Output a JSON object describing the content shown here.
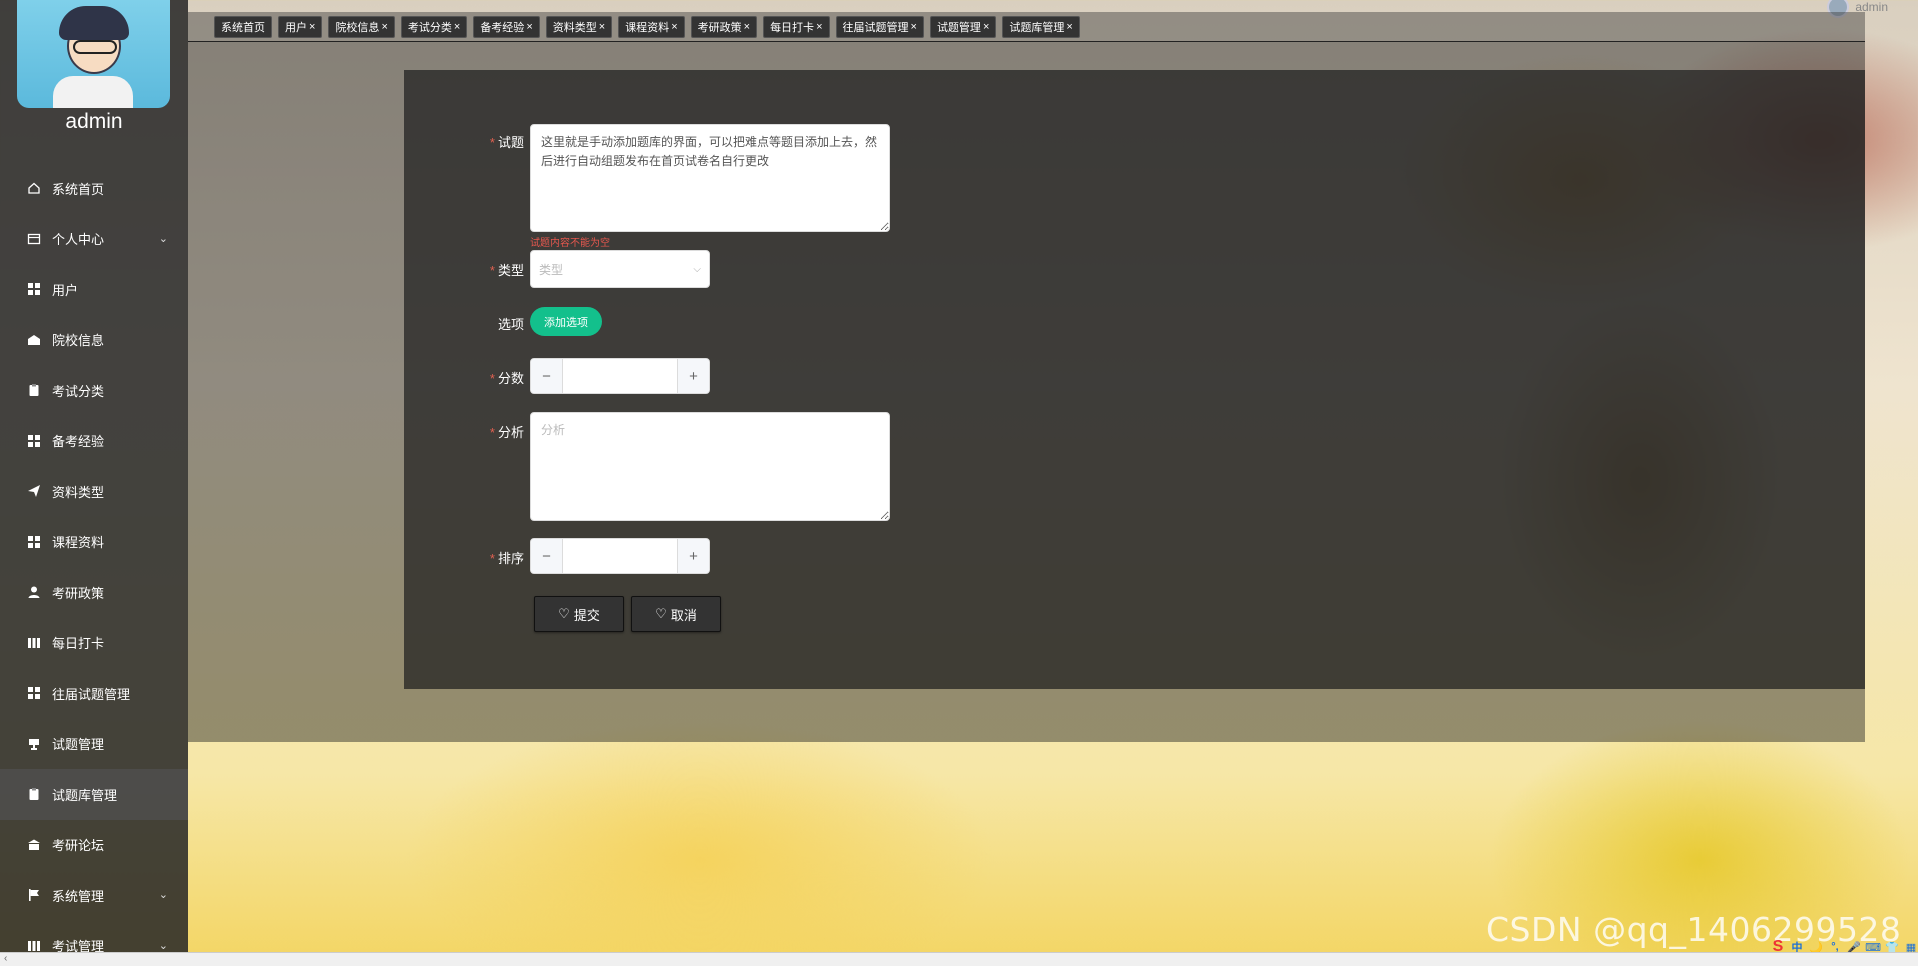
{
  "sidebar": {
    "username": "admin",
    "items": [
      {
        "label": "系统首页",
        "icon": "home-icon",
        "expand": false
      },
      {
        "label": "个人中心",
        "icon": "profile-icon",
        "expand": true
      },
      {
        "label": "用户",
        "icon": "grid-icon",
        "expand": false
      },
      {
        "label": "院校信息",
        "icon": "school-icon",
        "expand": false
      },
      {
        "label": "考试分类",
        "icon": "clipboard-icon",
        "expand": false
      },
      {
        "label": "备考经验",
        "icon": "grid-icon",
        "expand": false
      },
      {
        "label": "资料类型",
        "icon": "send-icon",
        "expand": false
      },
      {
        "label": "课程资料",
        "icon": "grid-icon",
        "expand": false
      },
      {
        "label": "考研政策",
        "icon": "user-icon",
        "expand": false
      },
      {
        "label": "每日打卡",
        "icon": "chart-icon",
        "expand": false
      },
      {
        "label": "往届试题管理",
        "icon": "grid-icon",
        "expand": false
      },
      {
        "label": "试题管理",
        "icon": "cup-icon",
        "expand": false
      },
      {
        "label": "试题库管理",
        "icon": "clipboard-icon",
        "expand": false,
        "active": true
      },
      {
        "label": "考研论坛",
        "icon": "bank-icon",
        "expand": false
      },
      {
        "label": "系统管理",
        "icon": "flag-icon",
        "expand": true
      },
      {
        "label": "考试管理",
        "icon": "chart-icon",
        "expand": true
      }
    ]
  },
  "top_user": "admin",
  "tabs": [
    "系统首页",
    "用户",
    "院校信息",
    "考试分类",
    "备考经验",
    "资料类型",
    "课程资料",
    "考研政策",
    "每日打卡",
    "往届试题管理",
    "试题管理",
    "试题库管理"
  ],
  "form": {
    "question_label": "试题",
    "question_value": "这里就是手动添加题库的界面，可以把难点等题目添加上去，然后进行自动组题发布在首页试卷名自行更改",
    "question_error": "试题内容不能为空",
    "type_label": "类型",
    "type_placeholder": "类型",
    "options_label": "选项",
    "add_option_button": "添加选项",
    "score_label": "分数",
    "stepper_minus": "−",
    "stepper_plus": "+",
    "analysis_label": "分析",
    "analysis_placeholder": "分析",
    "sort_label": "排序",
    "submit_button": "提交",
    "cancel_button": "取消",
    "required_mark": "*"
  },
  "watermark": "CSDN @qq_1406299528",
  "ime_tray": [
    "S",
    "中",
    "🌙",
    "°,",
    "🎤",
    "⌨",
    "👕",
    "▦"
  ]
}
